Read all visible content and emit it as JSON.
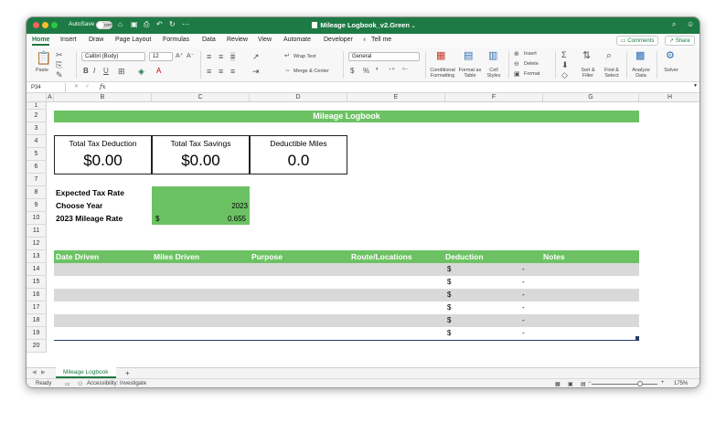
{
  "window": {
    "title": "Mileage Logbook_v2.Green",
    "autosave_label": "AutoSave",
    "autosave_state": "OFF"
  },
  "ribbon_tabs": [
    "Home",
    "Insert",
    "Draw",
    "Page Layout",
    "Formulas",
    "Data",
    "Review",
    "View",
    "Automate",
    "Developer"
  ],
  "tell_me": "Tell me",
  "comments_label": "Comments",
  "share_label": "Share",
  "ribbon": {
    "paste": "Paste",
    "font_name": "Calibri (Body)",
    "font_size": "12",
    "wrap_text": "Wrap Text",
    "merge_center": "Merge & Center",
    "number_format": "General",
    "conditional_formatting": "Conditional Formatting",
    "format_as_table": "Format as Table",
    "cell_styles": "Cell Styles",
    "insert": "Insert",
    "delete": "Delete",
    "format": "Format",
    "sort_filter": "Sort & Filter",
    "find_select": "Find & Select",
    "analyze_data": "Analyze Data",
    "solver": "Solver"
  },
  "formula_bar": {
    "name_box": "P34",
    "fx": "fx"
  },
  "columns": [
    "A",
    "B",
    "C",
    "D",
    "E",
    "F",
    "G",
    "H"
  ],
  "rows": [
    "1",
    "2",
    "3",
    "4",
    "5",
    "6",
    "7",
    "8",
    "9",
    "10",
    "11",
    "12",
    "13",
    "14",
    "15",
    "16",
    "17",
    "18",
    "19",
    "20"
  ],
  "sheet": {
    "title": "Mileage Logbook",
    "kpis": [
      {
        "label": "Total Tax Deduction",
        "value": "$0.00"
      },
      {
        "label": "Total Tax Savings",
        "value": "$0.00"
      },
      {
        "label": "Deductible Miles",
        "value": "0.0"
      }
    ],
    "params": {
      "tax_rate_label": "Expected Tax Rate",
      "year_label": "Choose Year",
      "year_value": "2023",
      "mileage_rate_label": "2023 Mileage Rate",
      "mileage_rate_currency": "$",
      "mileage_rate_value": "0.655"
    },
    "table_headers": [
      "Date Driven",
      "Miles Driven",
      "Purpose",
      "Route/Locations",
      "Deduction",
      "Notes"
    ],
    "table_rows": [
      {
        "currency": "$",
        "deduction": "-"
      },
      {
        "currency": "$",
        "deduction": "-"
      },
      {
        "currency": "$",
        "deduction": "-"
      },
      {
        "currency": "$",
        "deduction": "-"
      },
      {
        "currency": "$",
        "deduction": "-"
      },
      {
        "currency": "$",
        "deduction": "-"
      }
    ]
  },
  "sheet_tabs": [
    "Mileage Logbook"
  ],
  "status": {
    "ready": "Ready",
    "accessibility": "Accessibility: Investigate",
    "zoom": "175%"
  },
  "colors": {
    "excel_green": "#1e7a44",
    "sheet_green": "#6cc263",
    "row_gray": "#d9d9d9"
  }
}
